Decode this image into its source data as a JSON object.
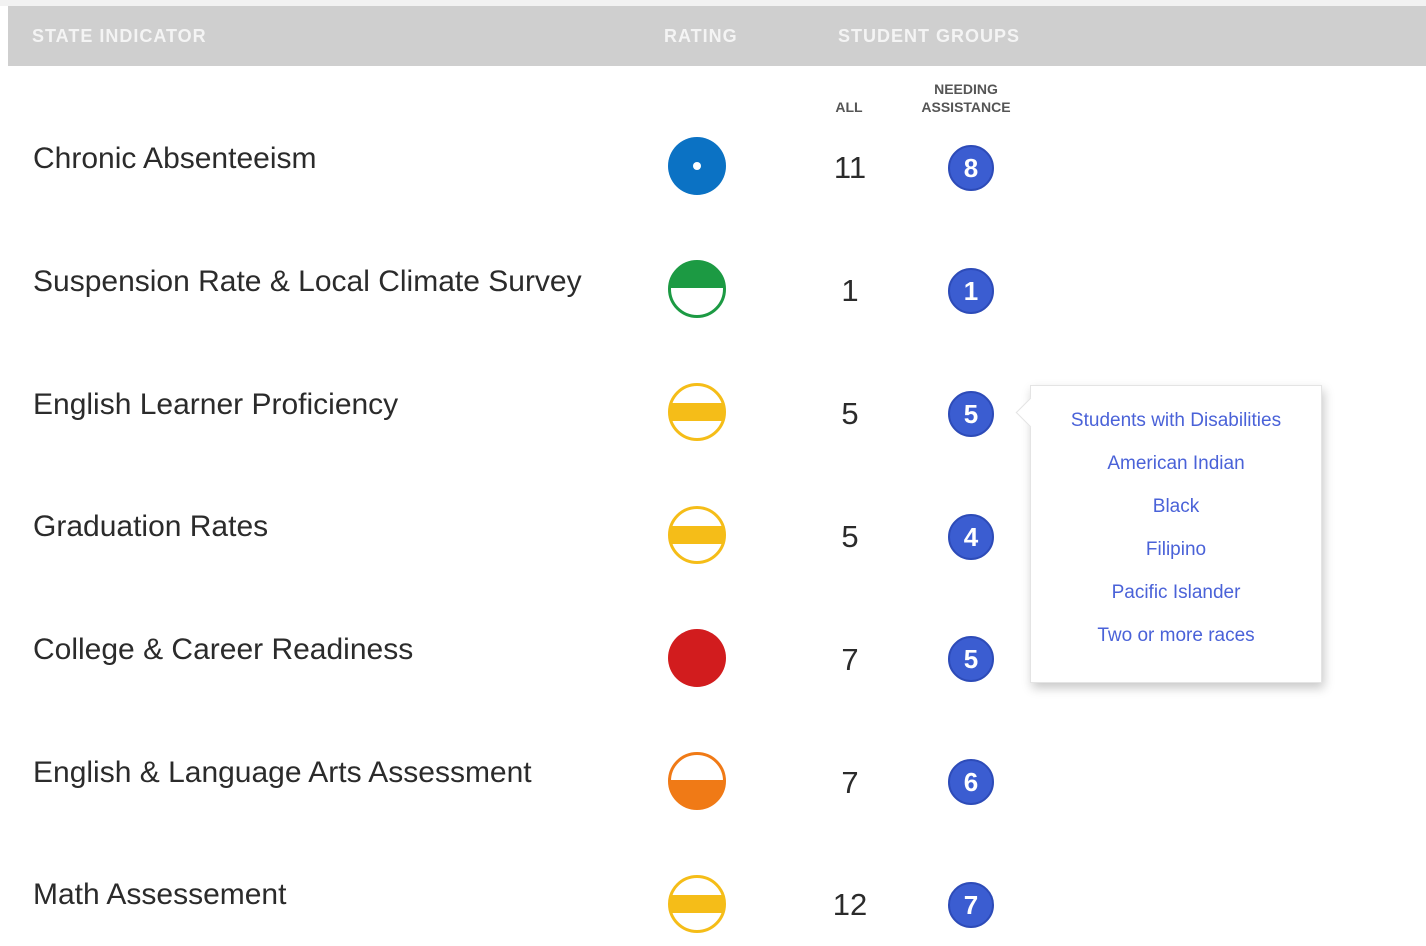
{
  "header": {
    "indicator_label": "STATE INDICATOR",
    "rating_label": "RATING",
    "groups_label": "STUDENT GROUPS"
  },
  "subheader": {
    "all_label": "ALL",
    "needing_line1": "NEEDING",
    "needing_line2": "ASSISTANCE"
  },
  "colors": {
    "blue": "#0b72c4",
    "green": "#1c9a43",
    "yellow": "#f5bd18",
    "red": "#d21c1e",
    "orange": "#f07a16",
    "badge": "#3b5dd1",
    "link": "#4a62d8"
  },
  "rows": [
    {
      "indicator": "Chronic Absenteeism",
      "rating_icon": "blue-dot-circle-icon",
      "all": "11",
      "needing": "8"
    },
    {
      "indicator": "Suspension Rate & Local Climate Survey",
      "rating_icon": "green-half-filled-top-circle-icon",
      "all": "1",
      "needing": "1"
    },
    {
      "indicator": "English Learner Proficiency",
      "rating_icon": "yellow-band-circle-icon",
      "all": "5",
      "needing": "5"
    },
    {
      "indicator": "Graduation Rates",
      "rating_icon": "yellow-band-circle-icon",
      "all": "5",
      "needing": "4"
    },
    {
      "indicator": "College & Career Readiness",
      "rating_icon": "red-filled-circle-icon",
      "all": "7",
      "needing": "5"
    },
    {
      "indicator": "English & Language Arts Assessment",
      "rating_icon": "orange-half-filled-bottom-circle-icon",
      "all": "7",
      "needing": "6"
    },
    {
      "indicator": "Math Assessement",
      "rating_icon": "yellow-band-circle-icon",
      "all": "12",
      "needing": "7"
    }
  ],
  "popover": {
    "items": [
      "Students with Disabilities",
      "American Indian",
      "Black",
      "Filipino",
      "Pacific Islander",
      "Two or more races"
    ]
  }
}
